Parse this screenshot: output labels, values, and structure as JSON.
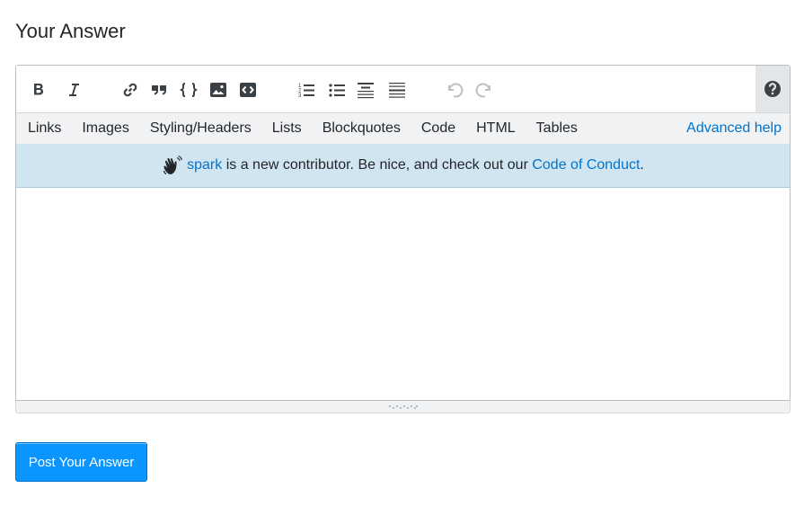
{
  "heading": "Your Answer",
  "toolbar": {
    "buttons": [
      {
        "name": "bold-icon",
        "title": "Bold"
      },
      {
        "name": "italic-icon",
        "title": "Italic"
      },
      {
        "name": "link-icon",
        "title": "Hyperlink"
      },
      {
        "name": "blockquote-icon",
        "title": "Blockquote"
      },
      {
        "name": "code-icon",
        "title": "Code Sample"
      },
      {
        "name": "image-icon",
        "title": "Image"
      },
      {
        "name": "snippet-icon",
        "title": "Stack Snippet"
      },
      {
        "name": "ordered-list-icon",
        "title": "Numbered List"
      },
      {
        "name": "bulleted-list-icon",
        "title": "Bulleted List"
      },
      {
        "name": "heading-icon",
        "title": "Heading"
      },
      {
        "name": "horizontal-rule-icon",
        "title": "Horizontal Rule"
      },
      {
        "name": "undo-icon",
        "title": "Undo"
      },
      {
        "name": "redo-icon",
        "title": "Redo"
      },
      {
        "name": "help-icon",
        "title": "Help"
      }
    ]
  },
  "help_tabs": [
    "Links",
    "Images",
    "Styling/Headers",
    "Lists",
    "Blockquotes",
    "Code",
    "HTML",
    "Tables"
  ],
  "advanced_help": "Advanced help",
  "notice": {
    "user": "spark",
    "text": " is a new contributor. Be nice, and check out our ",
    "link": "Code of Conduct",
    "end": "."
  },
  "editor": {
    "value": ""
  },
  "submit_label": "Post Your Answer",
  "colors": {
    "accent": "#0a95ff",
    "link": "#0074cc",
    "notice_bg": "#d1e5f1"
  }
}
